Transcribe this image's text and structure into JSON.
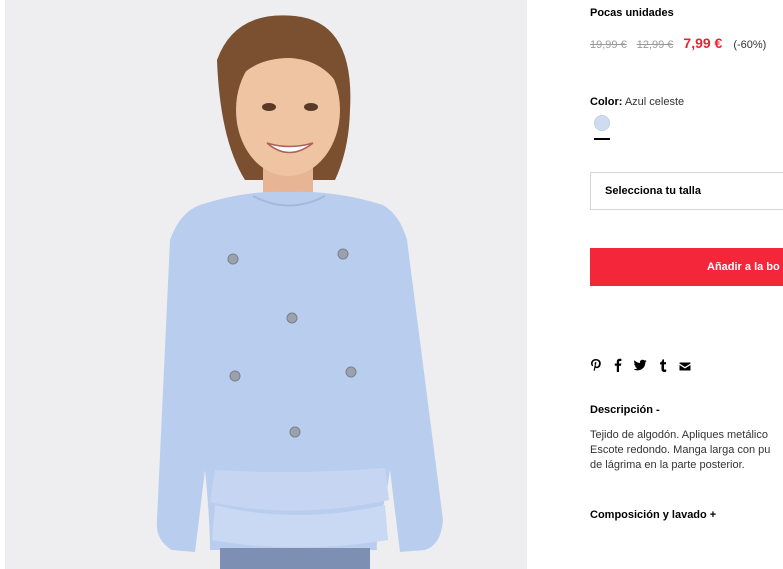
{
  "product": {
    "stock_label": "Pocas unidades",
    "price_original": "19,99 €",
    "price_previous": "12,99 €",
    "price_current": "7,99 €",
    "discount": "(-60%)",
    "color_label": "Color:",
    "color_value": "Azul celeste",
    "swatch_color": "#cfdcef",
    "size_select_label": "Selecciona tu talla",
    "add_button_label": "Añadir a la bo",
    "accent_color": "#f3263a"
  },
  "share_icons": [
    "pinterest-icon",
    "facebook-icon",
    "twitter-icon",
    "tumblr-icon",
    "mail-icon"
  ],
  "description": {
    "title": "Descripción -",
    "lines": [
      "Tejido de algodón. Apliques metálico",
      "Escote redondo. Manga larga con pu",
      "de lágrima en la parte posterior."
    ]
  },
  "composition": {
    "title": "Composición y lavado +"
  }
}
